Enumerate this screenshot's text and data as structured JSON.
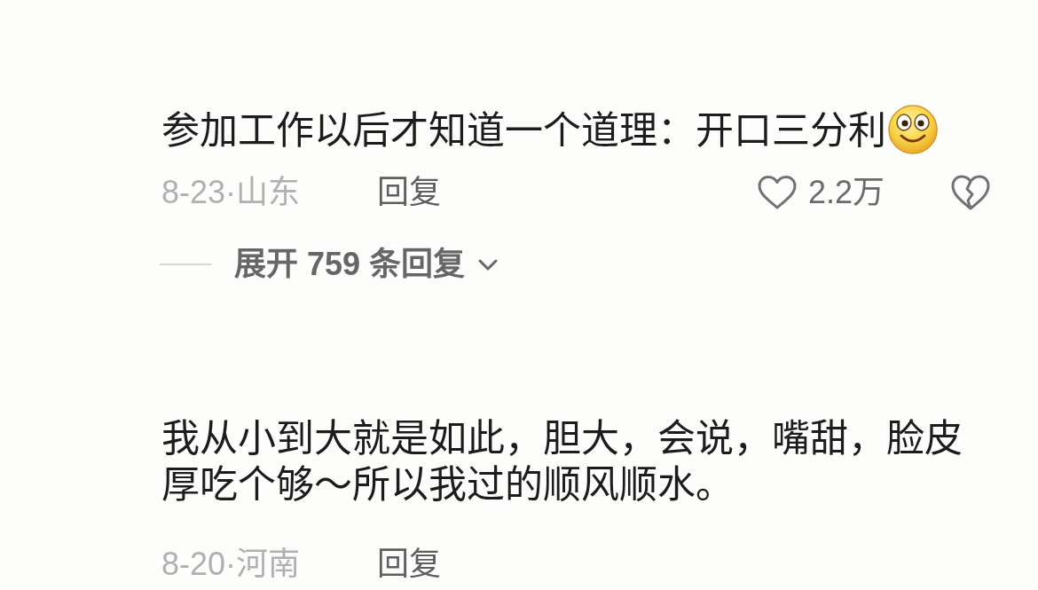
{
  "comments": [
    {
      "text": "参加工作以后才知道一个道理：开口三分利",
      "ends_with_emoji": true,
      "meta": "8-23·山东",
      "reply_label": "回复",
      "reactions": {
        "likes": "2.2万"
      },
      "expand_replies": "展开 759 条回复"
    },
    {
      "text": "我从小到大就是如此，胆大，会说，嘴甜，脸皮厚吃个够～所以我过的顺风顺水。",
      "ends_with_emoji": false,
      "meta": "8-20·河南",
      "reply_label": "回复"
    }
  ]
}
